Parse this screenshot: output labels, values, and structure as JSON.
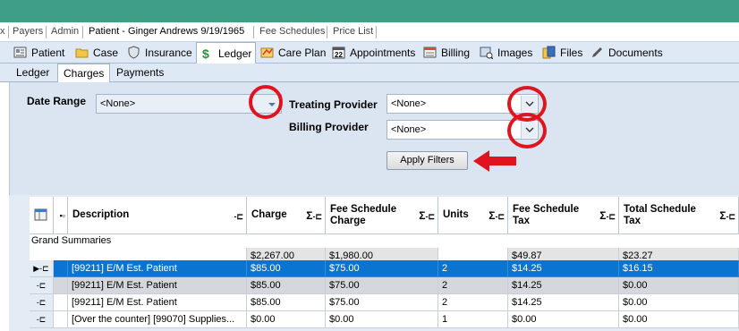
{
  "top_tabs": [
    "x",
    "Payers",
    "Admin",
    "Patient - Ginger Andrews 9/19/1965",
    "Fee Schedules",
    "Price List"
  ],
  "module_tabs": [
    {
      "label": "Patient",
      "icon": "patient-card-icon"
    },
    {
      "label": "Case",
      "icon": "folder-icon"
    },
    {
      "label": "Insurance",
      "icon": "shield-icon"
    },
    {
      "label": "Ledger",
      "icon": "dollar-icon"
    },
    {
      "label": "Care Plan",
      "icon": "care-plan-icon"
    },
    {
      "label": "Appointments",
      "icon": "calendar-icon"
    },
    {
      "label": "Billing",
      "icon": "billing-icon"
    },
    {
      "label": "Images",
      "icon": "images-icon"
    },
    {
      "label": "Files",
      "icon": "files-icon"
    },
    {
      "label": "Documents",
      "icon": "pen-icon"
    }
  ],
  "active_module": "Ledger",
  "sub_tabs": [
    "Ledger",
    "Charges",
    "Payments"
  ],
  "active_sub_tab": "Charges",
  "filters": {
    "date_range_label": "Date Range",
    "date_range_value": "<None>",
    "treating_provider_label": "Treating Provider",
    "treating_provider_value": "<None>",
    "billing_provider_label": "Billing Provider",
    "billing_provider_value": "<None>",
    "apply_label": "Apply Filters"
  },
  "grid": {
    "columns": [
      "Description",
      "Charge",
      "Fee Schedule Charge",
      "Units",
      "Fee Schedule Tax",
      "Total Schedule Tax"
    ],
    "grand_summaries_label": "Grand Summaries",
    "summary": {
      "charge": "$2,267.00",
      "fee_charge": "$1,980.00",
      "units": "",
      "fee_tax": "$49.87",
      "total_tax": "$23.27"
    },
    "rows": [
      {
        "description": "[99211] E/M Est. Patient",
        "charge": "$85.00",
        "fee_charge": "$75.00",
        "units": "2",
        "fee_tax": "$14.25",
        "total_tax": "$16.15",
        "selected": true
      },
      {
        "description": "[99211] E/M Est. Patient",
        "charge": "$85.00",
        "fee_charge": "$75.00",
        "units": "2",
        "fee_tax": "$14.25",
        "total_tax": "$0.00"
      },
      {
        "description": "[99211] E/M Est. Patient",
        "charge": "$85.00",
        "fee_charge": "$75.00",
        "units": "2",
        "fee_tax": "$14.25",
        "total_tax": "$0.00"
      },
      {
        "description": "[Over the counter] [99070] Supplies...",
        "charge": "$0.00",
        "fee_charge": "$0.00",
        "units": "1",
        "fee_tax": "$0.00",
        "total_tax": "$0.00"
      }
    ]
  },
  "colors": {
    "title_bar": "#3f9e86",
    "selected_row": "#0b74d1",
    "highlight_circle": "#e0141f",
    "arrow": "#e0141f"
  }
}
